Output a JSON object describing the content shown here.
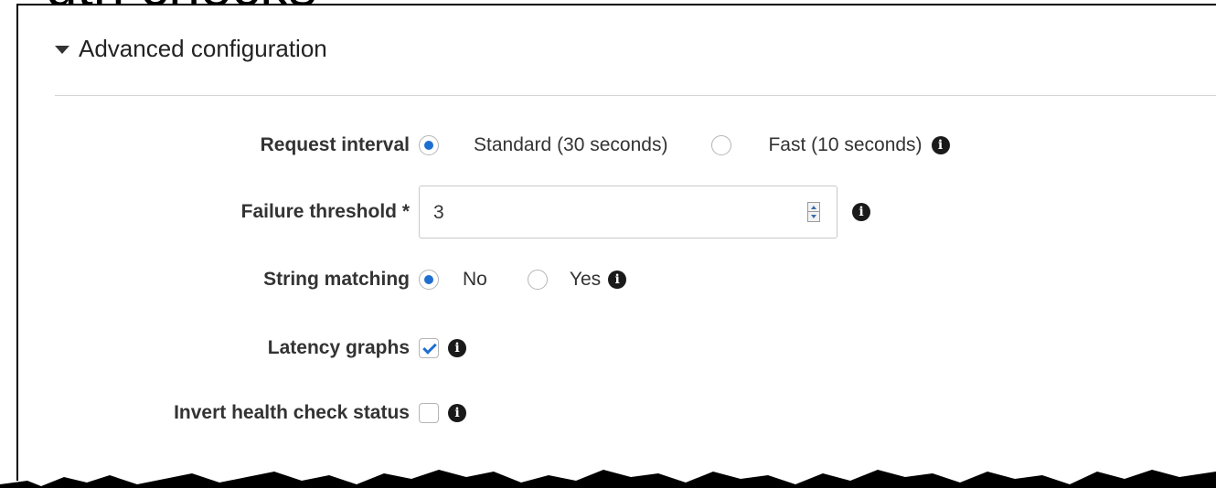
{
  "page_heading_fragment": "gth checks",
  "panel": {
    "title": "Advanced configuration"
  },
  "form": {
    "request_interval": {
      "label": "Request interval",
      "options": [
        {
          "label": "Standard (30 seconds)",
          "selected": true
        },
        {
          "label": "Fast (10 seconds)",
          "selected": false
        }
      ]
    },
    "failure_threshold": {
      "label": "Failure threshold *",
      "value": "3"
    },
    "string_matching": {
      "label": "String matching",
      "options": [
        {
          "label": "No",
          "selected": true
        },
        {
          "label": "Yes",
          "selected": false
        }
      ]
    },
    "latency_graphs": {
      "label": "Latency graphs",
      "checked": true
    },
    "invert_status": {
      "label": "Invert health check status",
      "checked": false
    }
  },
  "icons": {
    "info": "info-icon",
    "collapse": "caret-down-icon"
  },
  "colors": {
    "accent": "#1f6fd1",
    "text": "#333333",
    "border": "#c9c9c9"
  }
}
